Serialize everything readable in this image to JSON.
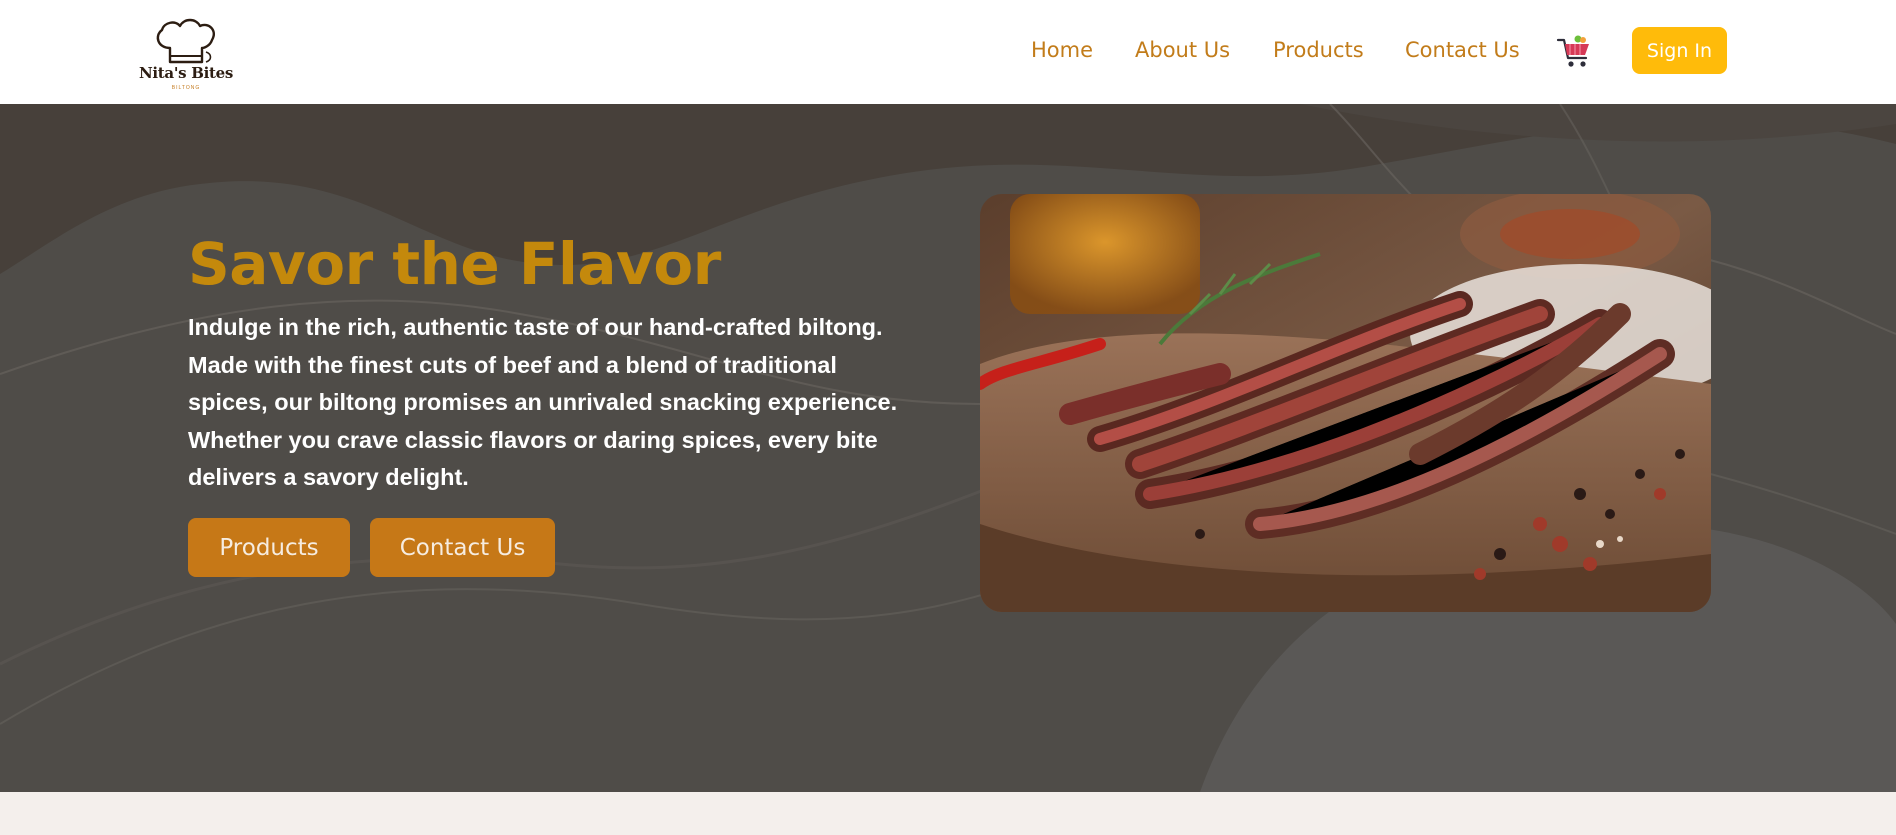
{
  "brand": {
    "name": "Nita's Bites",
    "tagline": "BILTONG",
    "logo_icon": "chef-hat-icon"
  },
  "nav": {
    "items": [
      {
        "label": "Home"
      },
      {
        "label": "About Us"
      },
      {
        "label": "Products"
      },
      {
        "label": "Contact Us"
      }
    ],
    "cart_icon": "shopping-cart-icon",
    "signin_label": "Sign In"
  },
  "hero": {
    "title": "Savor the Flavor",
    "description": "Indulge in the rich, authentic taste of our hand-crafted biltong. Made with the finest cuts of beef and a blend of traditional spices, our biltong promises an unrivaled snacking experience. Whether you crave classic flavors or daring spices, every bite delivers a savory delight.",
    "buttons": [
      {
        "label": "Products"
      },
      {
        "label": "Contact Us"
      }
    ],
    "image_subject": "biltong-on-wooden-board"
  },
  "colors": {
    "nav_text": "#c27c1a",
    "signin_bg": "#ffbb0a",
    "hero_bg": "#4f4c48",
    "headline": "#c4890c",
    "button_bg": "#c67817",
    "footer_bg": "#f4efec"
  }
}
